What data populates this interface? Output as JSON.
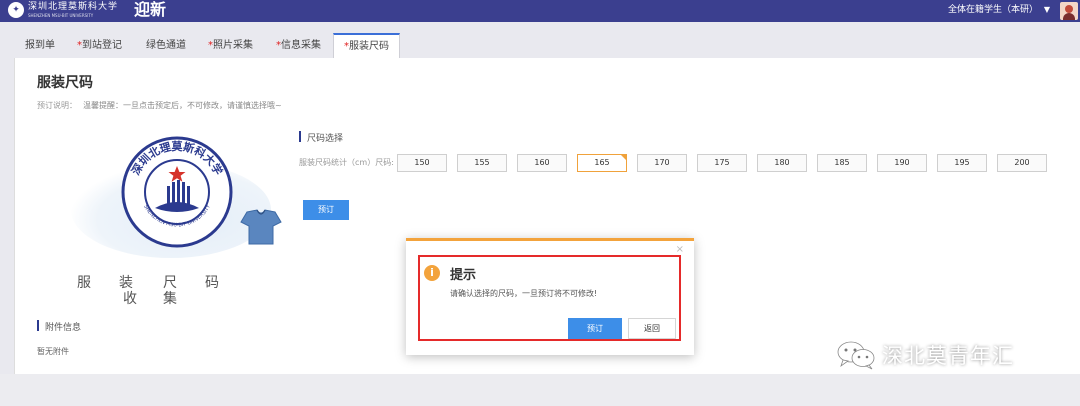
{
  "header": {
    "logo_text": "深圳北理莫斯科大学",
    "logo_subtext": "SHENZHEN MSU-BIT UNIVERSITY",
    "app_title": "迎新",
    "user_role": "全体在籍学生（本研）"
  },
  "tabs": [
    {
      "label": "报到单",
      "required": false
    },
    {
      "label": "到站登记",
      "required": true
    },
    {
      "label": "绿色通道",
      "required": false
    },
    {
      "label": "照片采集",
      "required": true
    },
    {
      "label": "信息采集",
      "required": true
    },
    {
      "label": "服装尺码",
      "required": true,
      "active": true
    }
  ],
  "tab_required_mark": "*",
  "page": {
    "title": "服装尺码",
    "notice_label": "预订说明：",
    "notice_text": "温馨提醒：一旦点击预定后，不可修改，请谨慎选择哦~"
  },
  "emblem": {
    "seal_text": "深圳北理莫斯科大学",
    "seal_en": "SHENZHEN MSU-BIT UNIVERSITY",
    "caption_chars": [
      "服",
      "装",
      "尺",
      "码",
      "收",
      "集"
    ]
  },
  "attachments": {
    "section_label": "附件信息",
    "empty_text": "暂无附件"
  },
  "size_selection": {
    "section_label": "尺码选择",
    "field_label": "服装尺码统计（cm）尺码:",
    "options": [
      "150",
      "155",
      "160",
      "165",
      "170",
      "175",
      "180",
      "185",
      "190",
      "195",
      "200"
    ],
    "selected": "165",
    "reserve_label": "预订"
  },
  "dialog": {
    "title": "提示",
    "message": "请确认选择的尺码，一旦预订将不可修改!",
    "confirm_label": "预订",
    "back_label": "返回",
    "close_glyph": "×",
    "icon_glyph": "i"
  },
  "watermark": {
    "text": "深北莫青年汇"
  },
  "colors": {
    "header_bg": "#3b3f8f",
    "accent_blue": "#3d8ee8",
    "warning_orange": "#f3a33c",
    "highlight_red": "#e52a2a"
  }
}
